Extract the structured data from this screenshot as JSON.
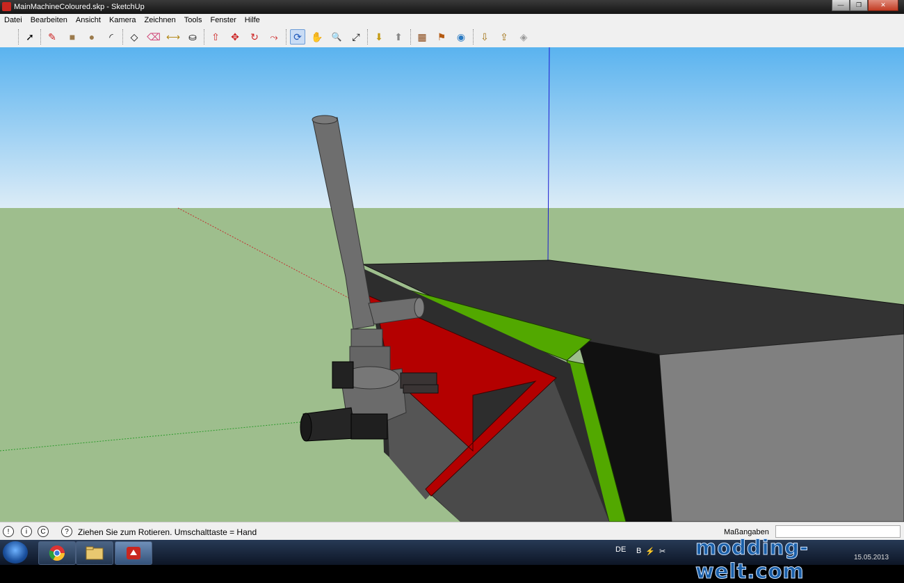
{
  "window": {
    "title": "MainMachineColoured.skp - SketchUp",
    "controls": {
      "minimize": "—",
      "maximize": "❐",
      "close": "✕"
    }
  },
  "menu": {
    "items": [
      "Datei",
      "Bearbeiten",
      "Ansicht",
      "Kamera",
      "Zeichnen",
      "Tools",
      "Fenster",
      "Hilfe"
    ]
  },
  "toolbar": {
    "tools": [
      {
        "name": "select-tool-icon",
        "glyph": "➚"
      },
      {
        "name": "line-tool-icon",
        "glyph": "✎"
      },
      {
        "name": "rectangle-tool-icon",
        "glyph": "■"
      },
      {
        "name": "circle-tool-icon",
        "glyph": "●"
      },
      {
        "name": "arc-tool-icon",
        "glyph": "◜"
      },
      {
        "name": "make-component-icon",
        "glyph": "◇"
      },
      {
        "name": "eraser-tool-icon",
        "glyph": "⌫"
      },
      {
        "name": "tape-measure-icon",
        "glyph": "⟷"
      },
      {
        "name": "paint-bucket-icon",
        "glyph": "⛀"
      },
      {
        "name": "push-pull-icon",
        "glyph": "⇧"
      },
      {
        "name": "move-tool-icon",
        "glyph": "✥"
      },
      {
        "name": "rotate-tool-icon",
        "glyph": "↻"
      },
      {
        "name": "follow-me-icon",
        "glyph": "⤳"
      },
      {
        "name": "orbit-tool-icon",
        "glyph": "⟳"
      },
      {
        "name": "pan-tool-icon",
        "glyph": "✋"
      },
      {
        "name": "zoom-tool-icon",
        "glyph": "🔍"
      },
      {
        "name": "zoom-extents-icon",
        "glyph": "⤢"
      },
      {
        "name": "get-models-icon",
        "glyph": "⬇"
      },
      {
        "name": "share-model-icon",
        "glyph": "⬆"
      },
      {
        "name": "share-component-icon",
        "glyph": "▦"
      },
      {
        "name": "position-camera-icon",
        "glyph": "⚑"
      },
      {
        "name": "walk-tool-icon",
        "glyph": "♟"
      },
      {
        "name": "google-earth-icon",
        "glyph": "◉"
      },
      {
        "name": "get-current-view-icon",
        "glyph": "⇩"
      },
      {
        "name": "toggle-terrain-icon",
        "glyph": "⇪"
      },
      {
        "name": "place-model-icon",
        "glyph": "◈"
      }
    ]
  },
  "status": {
    "message": "Ziehen Sie zum Rotieren.  Umschalttaste = Hand",
    "measure_label": "Maßangaben",
    "measure_value": ""
  },
  "taskbar": {
    "language": "DE",
    "date": "15.05.2013"
  },
  "watermark": "modding-welt.com"
}
